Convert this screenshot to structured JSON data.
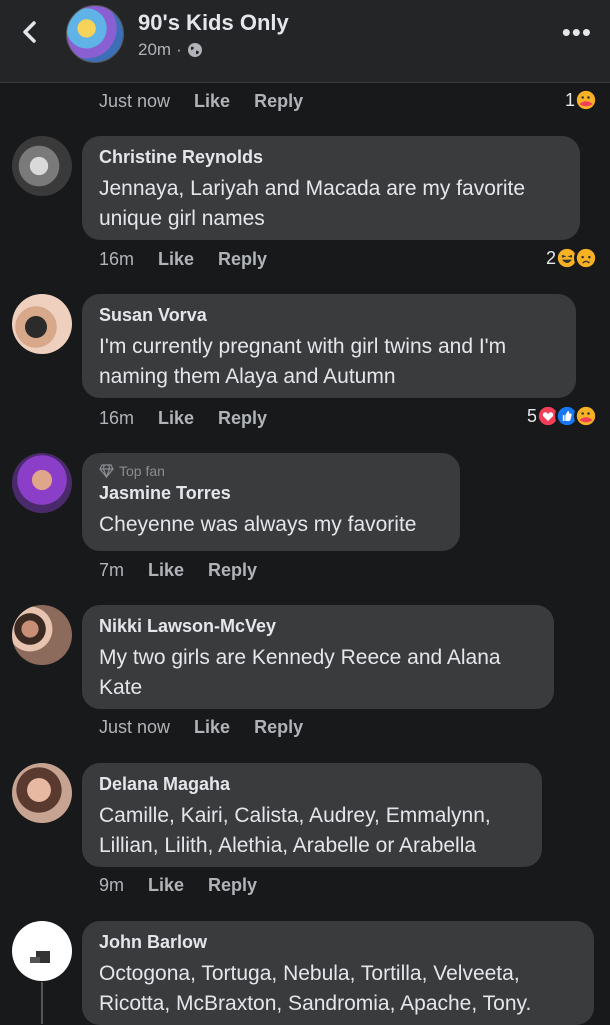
{
  "header": {
    "group_name": "90's Kids Only",
    "time": "20m",
    "dot": "·"
  },
  "top_row": {
    "time": "Just now",
    "like": "Like",
    "reply": "Reply",
    "reaction_count": "1"
  },
  "comments": [
    {
      "author": "Christine Reynolds",
      "text": "Jennaya, Lariyah and Macada are my favorite unique girl names",
      "time": "16m",
      "like": "Like",
      "reply": "Reply",
      "reaction_count": "2",
      "reactions": [
        "haha-icon",
        "sad-icon"
      ]
    },
    {
      "author": "Susan Vorva",
      "text": "I'm currently pregnant with girl twins and I'm naming them Alaya and Autumn",
      "time": "16m",
      "like": "Like",
      "reply": "Reply",
      "reaction_count": "5",
      "reactions": [
        "love-icon",
        "like-icon",
        "care-icon"
      ]
    },
    {
      "badge": "Top fan",
      "author": "Jasmine Torres",
      "text": "Cheyenne was always my favorite",
      "time": "7m",
      "like": "Like",
      "reply": "Reply"
    },
    {
      "author": "Nikki Lawson-McVey",
      "text": "My two girls are Kennedy Reece and Alana Kate",
      "time": "Just now",
      "like": "Like",
      "reply": "Reply"
    },
    {
      "author": "Delana Magaha",
      "text": "Camille, Kairi, Calista, Audrey, Emmalynn, Lillian, Lilith, Alethia, Arabelle or Arabella",
      "time": "9m",
      "like": "Like",
      "reply": "Reply"
    },
    {
      "author": "John Barlow",
      "text": "Octogona, Tortuga, Nebula, Tortilla, Velveeta, Ricotta, McBraxton, Sandromia, Apache, Tony."
    }
  ],
  "colors": {
    "background": "#18191a",
    "bubble": "#3a3b3c",
    "text": "#e4e6eb",
    "secondary_text": "#b0b3b8"
  }
}
